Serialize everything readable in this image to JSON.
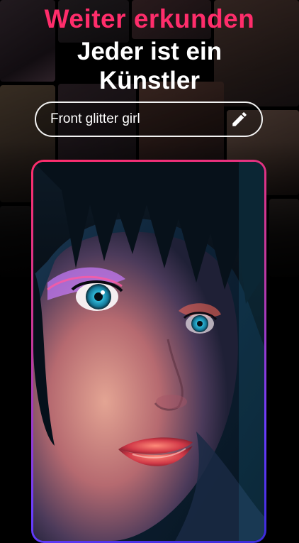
{
  "headline": {
    "title": "Weiter erkunden",
    "subtitle_line1": "Jeder ist ein",
    "subtitle_line2": "Künstler"
  },
  "prompt": {
    "text": "Front glitter girl",
    "edit_icon": "pencil-icon"
  },
  "colors": {
    "accent": "#ff2d6b",
    "card_border_top": "#ff2d6b",
    "card_border_bottom": "#3a2bd8",
    "background": "#000000",
    "text": "#ffffff"
  }
}
